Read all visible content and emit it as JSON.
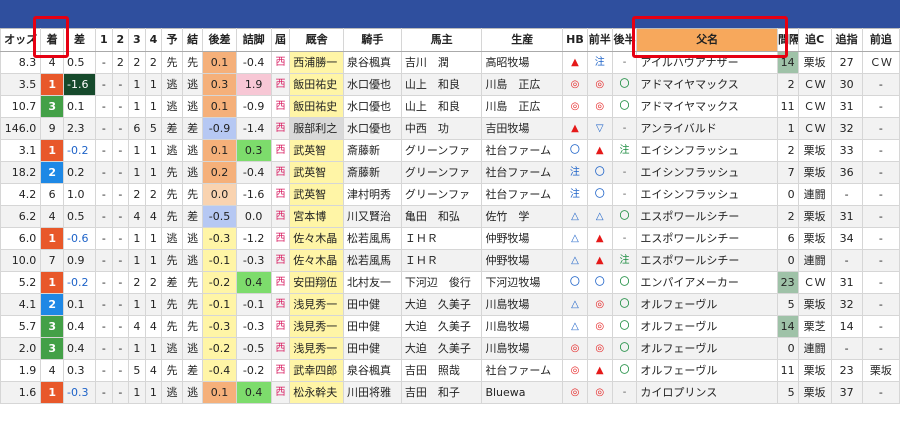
{
  "headers": [
    "オッズ",
    "着",
    "差",
    "1",
    "2",
    "3",
    "4",
    "予",
    "結",
    "後差",
    "詰脚",
    "屆",
    "厩舎",
    "騎手",
    "馬主",
    "生産",
    "HB",
    "前半",
    "後半",
    "父名",
    "間隔",
    "追C",
    "追指",
    "前追"
  ],
  "colors": {
    "rank1": "#e8582a",
    "rank2": "#1e88e5",
    "rank3": "#43a047",
    "rank4": "#ffffff",
    "rank5": "#ffffff",
    "orange": "#f5b07a",
    "lightorange": "#f9d3b0",
    "blue": "#b6c8f3",
    "yellow": "#fff5a6",
    "pink": "#f7c7d5",
    "green": "#7ddc6c",
    "darkgreen": "#164a2c",
    "gray": "#d9d9d9",
    "teal": "#9fc2a8"
  },
  "rows": [
    {
      "odds": "8.3",
      "rank": "4",
      "diff": "0.5",
      "p1": "-",
      "p2": "2",
      "p3": "2",
      "p4": "2",
      "yo": "先",
      "ke": "先",
      "atosa": "0.1",
      "tsume": "-0.4",
      "todoke": "西",
      "trainer": "西浦勝一",
      "jockey": "泉谷楓真",
      "owner": "吉川　潤",
      "breeder": "高昭牧場",
      "hb": "▲",
      "zen": "注",
      "kou": "-",
      "sire": "アイルハヴアナザー",
      "kankaku": "14",
      "oic": "栗坂",
      "oishi": "27",
      "zenoi": "ＣＷ"
    },
    {
      "odds": "3.5",
      "rank": "1",
      "diff": "-1.6",
      "p1": "-",
      "p2": "-",
      "p3": "1",
      "p4": "1",
      "yo": "逃",
      "ke": "逃",
      "atosa": "0.3",
      "tsume": "1.9",
      "todoke": "西",
      "trainer": "飯田祐史",
      "jockey": "水口優也",
      "owner": "山上　和良",
      "breeder": "川島　正広",
      "hb": "◎",
      "zen": "◎",
      "kou": "〇",
      "sire": "アドマイヤマックス",
      "kankaku": "2",
      "oic": "ＣＷ",
      "oishi": "30",
      "zenoi": "-"
    },
    {
      "odds": "10.7",
      "rank": "3",
      "diff": "0.1",
      "p1": "-",
      "p2": "-",
      "p3": "1",
      "p4": "1",
      "yo": "逃",
      "ke": "逃",
      "atosa": "0.1",
      "tsume": "-0.9",
      "todoke": "西",
      "trainer": "飯田祐史",
      "jockey": "水口優也",
      "owner": "山上　和良",
      "breeder": "川島　正広",
      "hb": "◎",
      "zen": "◎",
      "kou": "〇",
      "sire": "アドマイヤマックス",
      "kankaku": "11",
      "oic": "ＣＷ",
      "oishi": "31",
      "zenoi": "-"
    },
    {
      "odds": "146.0",
      "rank": "9",
      "diff": "2.3",
      "p1": "-",
      "p2": "-",
      "p3": "6",
      "p4": "5",
      "yo": "差",
      "ke": "差",
      "atosa": "-0.9",
      "tsume": "-1.4",
      "todoke": "西",
      "trainer": "服部利之",
      "jockey": "水口優也",
      "owner": "中西　功",
      "breeder": "吉田牧場",
      "hb": "▲",
      "zen": "▽",
      "kou": "-",
      "sire": "アンライバルド",
      "kankaku": "1",
      "oic": "ＣＷ",
      "oishi": "32",
      "zenoi": "-"
    },
    {
      "odds": "3.1",
      "rank": "1",
      "diff": "-0.2",
      "p1": "-",
      "p2": "-",
      "p3": "1",
      "p4": "1",
      "yo": "逃",
      "ke": "逃",
      "atosa": "0.1",
      "tsume": "0.3",
      "todoke": "西",
      "trainer": "武英智",
      "jockey": "斎藤新",
      "owner": "グリーンファ",
      "breeder": "社台ファーム",
      "hb": "〇",
      "zen": "▲",
      "kou": "注",
      "sire": "エイシンフラッシュ",
      "kankaku": "2",
      "oic": "栗坂",
      "oishi": "33",
      "zenoi": "-"
    },
    {
      "odds": "18.2",
      "rank": "2",
      "diff": "0.2",
      "p1": "-",
      "p2": "-",
      "p3": "1",
      "p4": "1",
      "yo": "先",
      "ke": "逃",
      "atosa": "0.2",
      "tsume": "-0.4",
      "todoke": "西",
      "trainer": "武英智",
      "jockey": "斎藤新",
      "owner": "グリーンファ",
      "breeder": "社台ファーム",
      "hb": "注",
      "zen": "〇",
      "kou": "-",
      "sire": "エイシンフラッシュ",
      "kankaku": "7",
      "oic": "栗坂",
      "oishi": "36",
      "zenoi": "-"
    },
    {
      "odds": "4.2",
      "rank": "6",
      "diff": "1.0",
      "p1": "-",
      "p2": "-",
      "p3": "2",
      "p4": "2",
      "yo": "先",
      "ke": "先",
      "atosa": "0.0",
      "tsume": "-1.6",
      "todoke": "西",
      "trainer": "武英智",
      "jockey": "津村明秀",
      "owner": "グリーンファ",
      "breeder": "社台ファーム",
      "hb": "注",
      "zen": "〇",
      "kou": "-",
      "sire": "エイシンフラッシュ",
      "kankaku": "0",
      "oic": "連闘",
      "oishi": "-",
      "zenoi": "-"
    },
    {
      "odds": "6.2",
      "rank": "4",
      "diff": "0.5",
      "p1": "-",
      "p2": "-",
      "p3": "4",
      "p4": "4",
      "yo": "先",
      "ke": "差",
      "atosa": "-0.5",
      "tsume": "0.0",
      "todoke": "西",
      "trainer": "宮本博",
      "jockey": "川又賢治",
      "owner": "亀田　和弘",
      "breeder": "佐竹　学",
      "hb": "△",
      "zen": "△",
      "kou": "〇",
      "sire": "エスポワールシチー",
      "kankaku": "2",
      "oic": "栗坂",
      "oishi": "31",
      "zenoi": "-"
    },
    {
      "odds": "6.0",
      "rank": "1",
      "diff": "-0.6",
      "p1": "-",
      "p2": "-",
      "p3": "1",
      "p4": "1",
      "yo": "逃",
      "ke": "逃",
      "atosa": "-0.3",
      "tsume": "-1.2",
      "todoke": "西",
      "trainer": "佐々木晶",
      "jockey": "松若風馬",
      "owner": "ＩＨＲ",
      "breeder": "仲野牧場",
      "hb": "△",
      "zen": "▲",
      "kou": "-",
      "sire": "エスポワールシチー",
      "kankaku": "6",
      "oic": "栗坂",
      "oishi": "34",
      "zenoi": "-"
    },
    {
      "odds": "10.0",
      "rank": "7",
      "diff": "0.9",
      "p1": "-",
      "p2": "-",
      "p3": "1",
      "p4": "1",
      "yo": "先",
      "ke": "逃",
      "atosa": "-0.1",
      "tsume": "-0.3",
      "todoke": "西",
      "trainer": "佐々木晶",
      "jockey": "松若風馬",
      "owner": "ＩＨＲ",
      "breeder": "仲野牧場",
      "hb": "△",
      "zen": "▲",
      "kou": "注",
      "sire": "エスポワールシチー",
      "kankaku": "0",
      "oic": "連闘",
      "oishi": "-",
      "zenoi": "-"
    },
    {
      "odds": "5.2",
      "rank": "1",
      "diff": "-0.2",
      "p1": "-",
      "p2": "-",
      "p3": "2",
      "p4": "2",
      "yo": "差",
      "ke": "先",
      "atosa": "-0.2",
      "tsume": "0.4",
      "todoke": "西",
      "trainer": "安田翔伍",
      "jockey": "北村友一",
      "owner": "下河辺　俊行",
      "breeder": "下河辺牧場",
      "hb": "〇",
      "zen": "〇",
      "kou": "〇",
      "sire": "エンパイアメーカー",
      "kankaku": "23",
      "oic": "ＣＷ",
      "oishi": "31",
      "zenoi": "-"
    },
    {
      "odds": "4.1",
      "rank": "2",
      "diff": "0.1",
      "p1": "-",
      "p2": "-",
      "p3": "1",
      "p4": "1",
      "yo": "先",
      "ke": "先",
      "atosa": "-0.1",
      "tsume": "-0.1",
      "todoke": "西",
      "trainer": "浅見秀一",
      "jockey": "田中健",
      "owner": "大迫　久美子",
      "breeder": "川島牧場",
      "hb": "△",
      "zen": "◎",
      "kou": "〇",
      "sire": "オルフェーヴル",
      "kankaku": "5",
      "oic": "栗坂",
      "oishi": "32",
      "zenoi": "-"
    },
    {
      "odds": "5.7",
      "rank": "3",
      "diff": "0.4",
      "p1": "-",
      "p2": "-",
      "p3": "4",
      "p4": "4",
      "yo": "先",
      "ke": "先",
      "atosa": "-0.3",
      "tsume": "-0.3",
      "todoke": "西",
      "trainer": "浅見秀一",
      "jockey": "田中健",
      "owner": "大迫　久美子",
      "breeder": "川島牧場",
      "hb": "△",
      "zen": "◎",
      "kou": "〇",
      "sire": "オルフェーヴル",
      "kankaku": "14",
      "oic": "栗芝",
      "oishi": "14",
      "zenoi": "-"
    },
    {
      "odds": "2.0",
      "rank": "3",
      "diff": "0.4",
      "p1": "-",
      "p2": "-",
      "p3": "1",
      "p4": "1",
      "yo": "逃",
      "ke": "逃",
      "atosa": "-0.2",
      "tsume": "-0.5",
      "todoke": "西",
      "trainer": "浅見秀一",
      "jockey": "田中健",
      "owner": "大迫　久美子",
      "breeder": "川島牧場",
      "hb": "◎",
      "zen": "◎",
      "kou": "〇",
      "sire": "オルフェーヴル",
      "kankaku": "0",
      "oic": "連闘",
      "oishi": "-",
      "zenoi": "-"
    },
    {
      "odds": "1.9",
      "rank": "4",
      "diff": "0.3",
      "p1": "-",
      "p2": "-",
      "p3": "5",
      "p4": "4",
      "yo": "先",
      "ke": "差",
      "atosa": "-0.4",
      "tsume": "-0.2",
      "todoke": "西",
      "trainer": "武幸四郎",
      "jockey": "泉谷楓真",
      "owner": "吉田　照哉",
      "breeder": "社台ファーム",
      "hb": "◎",
      "zen": "▲",
      "kou": "〇",
      "sire": "オルフェーヴル",
      "kankaku": "11",
      "oic": "栗坂",
      "oishi": "23",
      "zenoi": "栗坂"
    },
    {
      "odds": "1.6",
      "rank": "1",
      "diff": "-0.3",
      "p1": "-",
      "p2": "-",
      "p3": "1",
      "p4": "1",
      "yo": "逃",
      "ke": "逃",
      "atosa": "0.1",
      "tsume": "0.4",
      "todoke": "西",
      "trainer": "松永幹夫",
      "jockey": "川田将雅",
      "owner": "吉田　和子",
      "breeder": "Bluewa",
      "hb": "◎",
      "zen": "◎",
      "kou": "-",
      "sire": "カイロプリンス",
      "kankaku": "5",
      "oic": "栗坂",
      "oishi": "37",
      "zenoi": "-"
    }
  ]
}
